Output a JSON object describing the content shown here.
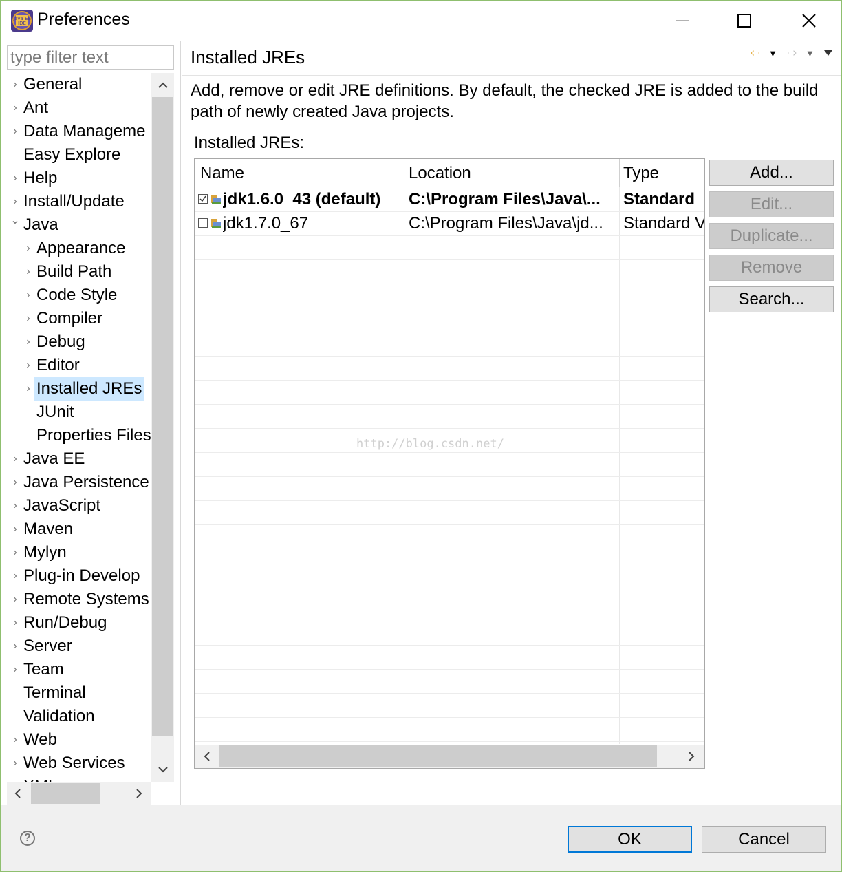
{
  "window": {
    "title": "Preferences",
    "min_glyph": "—",
    "max_glyph": "☐",
    "close_glyph": "✕"
  },
  "app_icon": {
    "name": "java-ee-ide-icon",
    "text": "Java EE IDE"
  },
  "filter": {
    "placeholder": "type filter text",
    "value": ""
  },
  "tree": {
    "items": [
      {
        "label": "General",
        "level": 0,
        "arrow": "right"
      },
      {
        "label": "Ant",
        "level": 0,
        "arrow": "right"
      },
      {
        "label": "Data Manageme",
        "level": 0,
        "arrow": "right"
      },
      {
        "label": "Easy Explore",
        "level": 0,
        "arrow": "none"
      },
      {
        "label": "Help",
        "level": 0,
        "arrow": "right"
      },
      {
        "label": "Install/Update",
        "level": 0,
        "arrow": "right"
      },
      {
        "label": "Java",
        "level": 0,
        "arrow": "down"
      },
      {
        "label": "Appearance",
        "level": 1,
        "arrow": "right"
      },
      {
        "label": "Build Path",
        "level": 1,
        "arrow": "right"
      },
      {
        "label": "Code Style",
        "level": 1,
        "arrow": "right"
      },
      {
        "label": "Compiler",
        "level": 1,
        "arrow": "right"
      },
      {
        "label": "Debug",
        "level": 1,
        "arrow": "right"
      },
      {
        "label": "Editor",
        "level": 1,
        "arrow": "right"
      },
      {
        "label": "Installed JREs",
        "level": 1,
        "arrow": "right",
        "selected": true
      },
      {
        "label": "JUnit",
        "level": 1,
        "arrow": "none"
      },
      {
        "label": "Properties Files",
        "level": 1,
        "arrow": "none"
      },
      {
        "label": "Java EE",
        "level": 0,
        "arrow": "right"
      },
      {
        "label": "Java Persistence",
        "level": 0,
        "arrow": "right"
      },
      {
        "label": "JavaScript",
        "level": 0,
        "arrow": "right"
      },
      {
        "label": "Maven",
        "level": 0,
        "arrow": "right"
      },
      {
        "label": "Mylyn",
        "level": 0,
        "arrow": "right"
      },
      {
        "label": "Plug-in Develop",
        "level": 0,
        "arrow": "right"
      },
      {
        "label": "Remote Systems",
        "level": 0,
        "arrow": "right"
      },
      {
        "label": "Run/Debug",
        "level": 0,
        "arrow": "right"
      },
      {
        "label": "Server",
        "level": 0,
        "arrow": "right"
      },
      {
        "label": "Team",
        "level": 0,
        "arrow": "right"
      },
      {
        "label": "Terminal",
        "level": 0,
        "arrow": "none"
      },
      {
        "label": "Validation",
        "level": 0,
        "arrow": "none"
      },
      {
        "label": "Web",
        "level": 0,
        "arrow": "right"
      },
      {
        "label": "Web Services",
        "level": 0,
        "arrow": "right"
      },
      {
        "label": "XML",
        "level": 0,
        "arrow": "right"
      }
    ]
  },
  "page": {
    "title": "Installed JREs",
    "description": "Add, remove or edit JRE definitions. By default, the checked JRE is added to the build path of newly created Java projects.",
    "section_label": "Installed JREs:",
    "nav": {
      "back": "⇦",
      "back_menu": "▼",
      "forward": "⇨",
      "forward_menu": "▼"
    }
  },
  "table": {
    "columns": [
      "Name",
      "Location",
      "Type"
    ],
    "rows": [
      {
        "checked": true,
        "bold": true,
        "name": "jdk1.6.0_43 (default)",
        "location": "C:\\Program Files\\Java\\...",
        "type": "Standard"
      },
      {
        "checked": false,
        "bold": false,
        "name": "jdk1.7.0_67",
        "location": "C:\\Program Files\\Java\\jd...",
        "type": "Standard V"
      }
    ]
  },
  "buttons": {
    "add": {
      "label": "Add...",
      "enabled": true
    },
    "edit": {
      "label": "Edit...",
      "enabled": false
    },
    "duplicate": {
      "label": "Duplicate...",
      "enabled": false
    },
    "remove": {
      "label": "Remove",
      "enabled": false
    },
    "search": {
      "label": "Search...",
      "enabled": true
    }
  },
  "watermark": "http://blog.csdn.net/",
  "dialog": {
    "help": "?",
    "ok": "OK",
    "cancel": "Cancel"
  },
  "colors": {
    "accent": "#0078d7",
    "selection": "#cde8ff",
    "window_border": "#8fbf6f"
  }
}
